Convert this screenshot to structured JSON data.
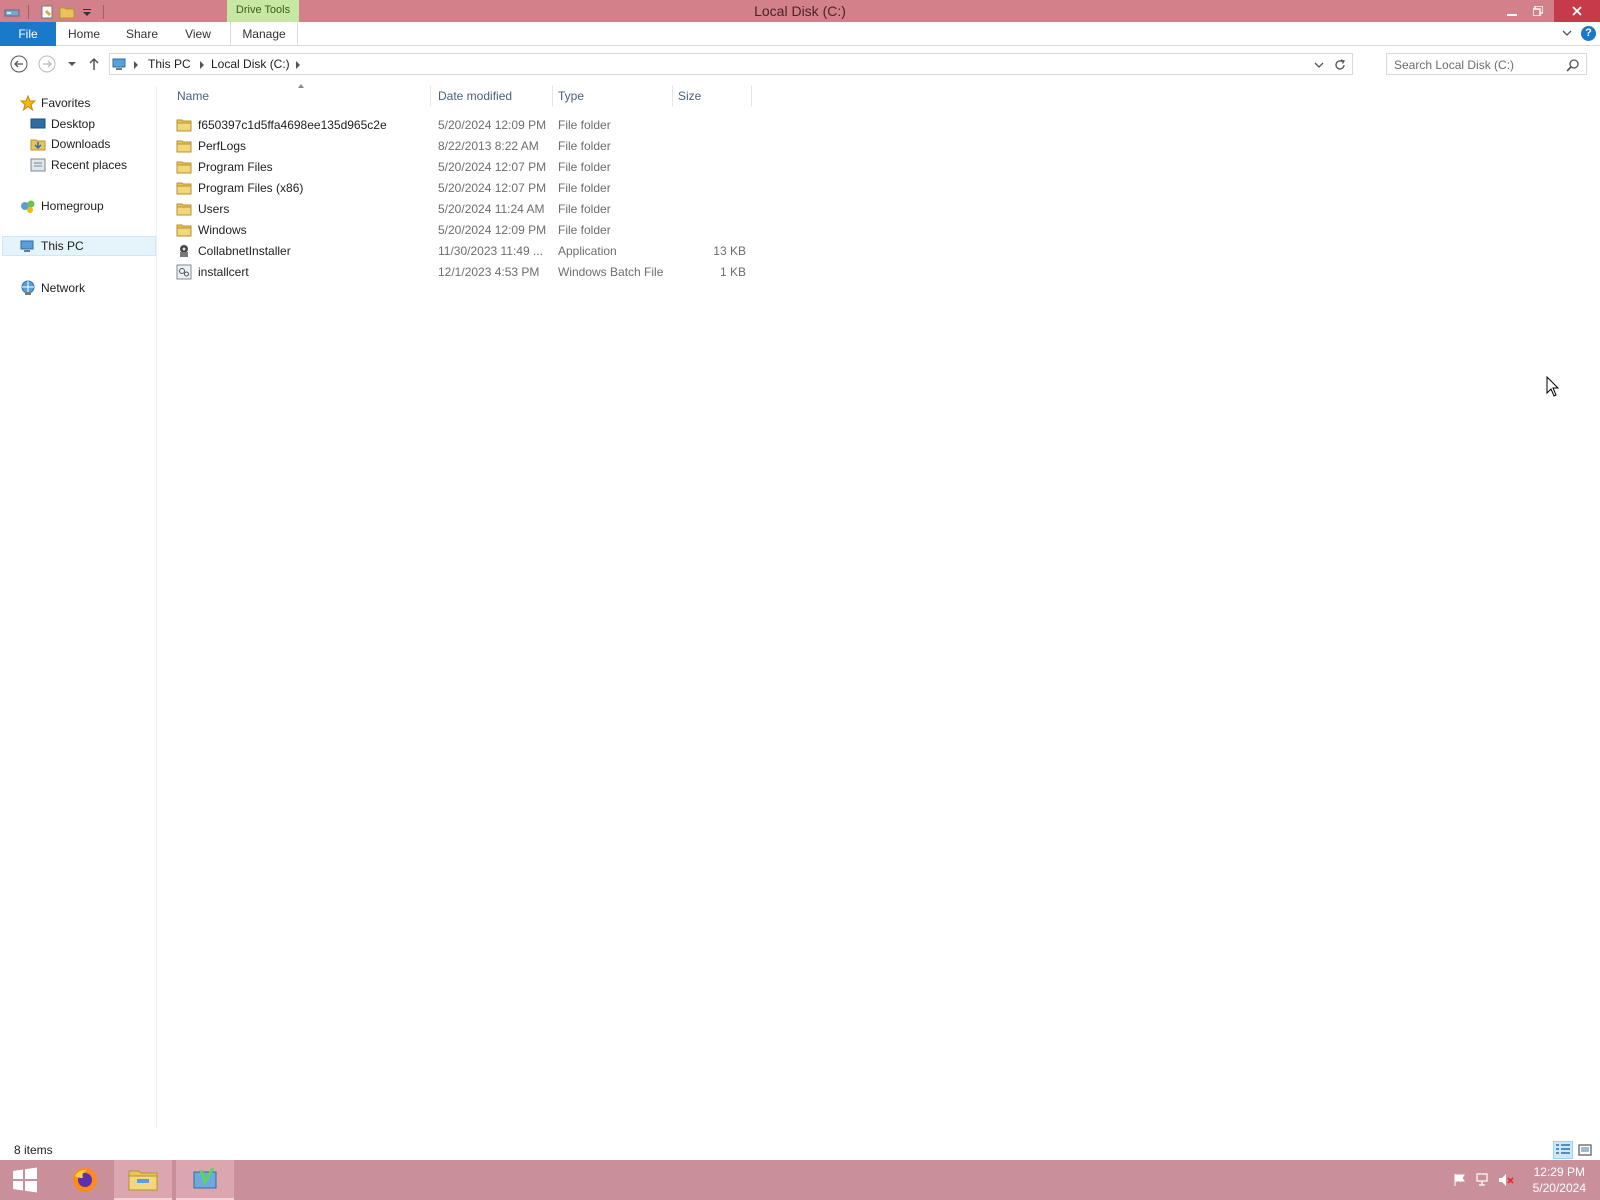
{
  "window": {
    "title": "Local Disk (C:)",
    "contextual_tab_group": "Drive Tools"
  },
  "ribbon": {
    "tabs": [
      {
        "label": "File"
      },
      {
        "label": "Home"
      },
      {
        "label": "Share"
      },
      {
        "label": "View"
      },
      {
        "label": "Manage"
      }
    ],
    "help_label": "?"
  },
  "address": {
    "crumbs": [
      "This PC",
      "Local Disk (C:)"
    ],
    "search_placeholder": "Search Local Disk (C:)"
  },
  "navpane": {
    "favorites_label": "Favorites",
    "favorites": [
      "Desktop",
      "Downloads",
      "Recent places"
    ],
    "homegroup": "Homegroup",
    "this_pc": "This PC",
    "network": "Network"
  },
  "columns": {
    "name": "Name",
    "date": "Date modified",
    "type": "Type",
    "size": "Size"
  },
  "files": [
    {
      "name": "f650397c1d5ffa4698ee135d965c2e",
      "date": "5/20/2024 12:09 PM",
      "type": "File folder",
      "size": "",
      "icon": "folder-icon"
    },
    {
      "name": "PerfLogs",
      "date": "8/22/2013 8:22 AM",
      "type": "File folder",
      "size": "",
      "icon": "folder-icon"
    },
    {
      "name": "Program Files",
      "date": "5/20/2024 12:07 PM",
      "type": "File folder",
      "size": "",
      "icon": "folder-icon"
    },
    {
      "name": "Program Files (x86)",
      "date": "5/20/2024 12:07 PM",
      "type": "File folder",
      "size": "",
      "icon": "folder-icon"
    },
    {
      "name": "Users",
      "date": "5/20/2024 11:24 AM",
      "type": "File folder",
      "size": "",
      "icon": "folder-icon"
    },
    {
      "name": "Windows",
      "date": "5/20/2024 12:09 PM",
      "type": "File folder",
      "size": "",
      "icon": "folder-icon"
    },
    {
      "name": "CollabnetInstaller",
      "date": "11/30/2023 11:49 ...",
      "type": "Application",
      "size": "13 KB",
      "icon": "application-icon"
    },
    {
      "name": "installcert",
      "date": "12/1/2023 4:53 PM",
      "type": "Windows Batch File",
      "size": "1 KB",
      "icon": "batch-file-icon"
    }
  ],
  "status": {
    "item_count": "8 items"
  },
  "taskbar": {
    "time": "12:29 PM",
    "date": "5/20/2024"
  },
  "colors": {
    "title_bar": "#d2808a",
    "file_tab": "#1979ca",
    "drive_tools": "#c7e8a2",
    "taskbar": "#c9909a",
    "folder": "#e8c45a"
  }
}
